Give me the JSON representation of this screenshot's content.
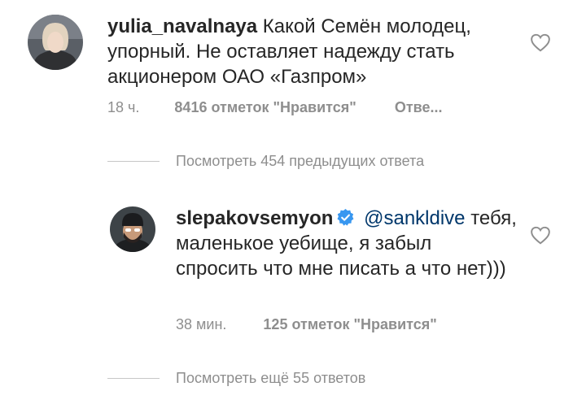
{
  "comments": [
    {
      "username": "yulia_navalnaya",
      "text": "Какой Семён молодец, упорный. Не оставляет надежду стать акционером  ОАО «Газпром»",
      "time": "18 ч.",
      "likes": "8416 отметок \"Нравится\"",
      "reply": "Отве..."
    },
    {
      "username": "slepakovsemyon",
      "verified": true,
      "mention": "@sankldive",
      "text": "тебя, маленькое уебище, я забыл спросить что мне писать а что нет)))",
      "time": "38 мин.",
      "likes": "125 отметок \"Нравится\""
    }
  ],
  "view_replies": [
    "Посмотреть 454 предыдущих ответа",
    "Посмотреть ещё 55 ответов"
  ],
  "colors": {
    "text": "#262626",
    "muted": "#8e8e8e",
    "mention": "#00376b",
    "verified": "#3897f0"
  }
}
